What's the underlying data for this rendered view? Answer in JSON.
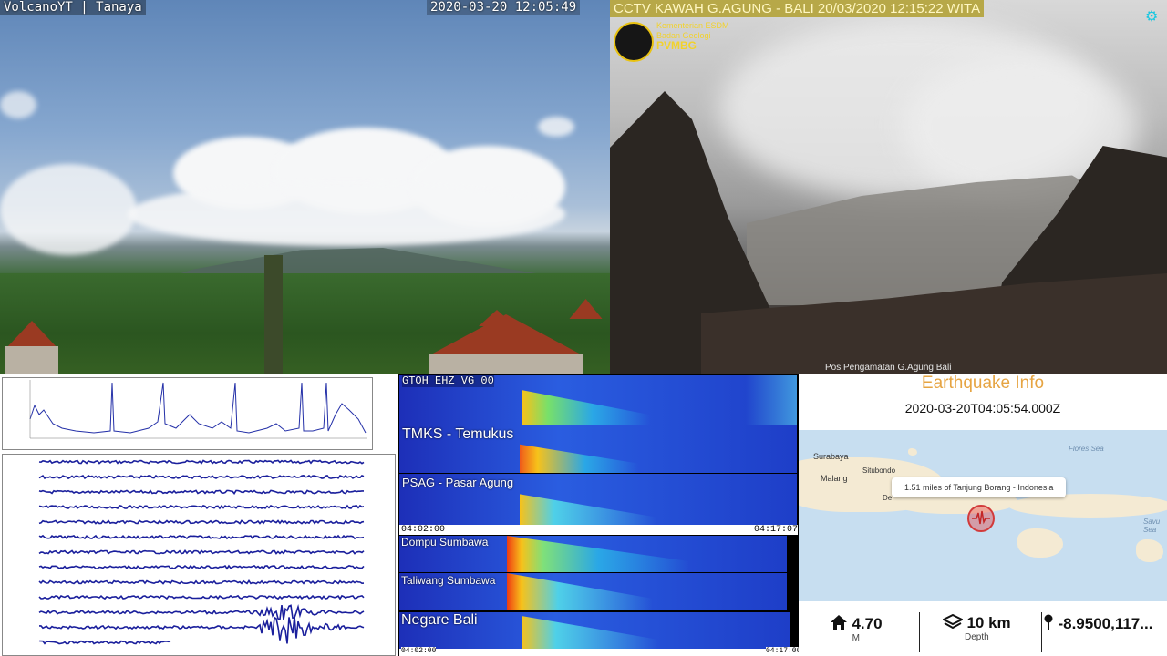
{
  "cam_left": {
    "label": "VolcanoYT | Tanaya",
    "timestamp": "2020-03-20 12:05:49"
  },
  "cam_right": {
    "label": "CCTV KAWAH G.AGUNG - BALI  20/03/2020 12:15:22 WITA",
    "org_line1": "Kementerian ESDM",
    "org_line2": "Badan Geologi",
    "org_line3": "PVMBG",
    "footer": "Pos Pengamatan G.Agung Bali"
  },
  "spectrograms": {
    "top_group": [
      {
        "station": "GTOH EHZ VG 00"
      },
      {
        "station": "TMKS - Temukus"
      },
      {
        "station": "PSAG - Pasar Agung"
      }
    ],
    "top_start": "04:02:00",
    "top_end": "04:17:07",
    "bottom_group": [
      {
        "station": "Dompu Sumbawa"
      },
      {
        "station": "Taliwang Sumbawa"
      },
      {
        "station": "Negare Bali"
      }
    ],
    "bottom_start": "04:02:00",
    "bottom_end": "04:17:00"
  },
  "earthquake": {
    "title": "Earthquake Info",
    "time": "2020-03-20T04:05:54.000Z",
    "popup": "1.51 miles of Tanjung Borang - Indonesia",
    "map_labels": [
      "Surabaya",
      "Malang",
      "Situbondo",
      "De"
    ],
    "sea_labels": [
      "Flores Sea",
      "Savu Sea"
    ],
    "magnitude": "4.70",
    "magnitude_unit": "M",
    "depth": "10 km",
    "depth_unit": "Depth",
    "location": "-8.9500,117..."
  },
  "icons": {
    "gear": "gear-icon",
    "home": "home-icon",
    "layers": "layers-icon",
    "pin": "map-pin-icon"
  },
  "colors": {
    "accent": "#19c7e0",
    "title_orange": "#e6a442",
    "cctv_bar": "#b7a848"
  }
}
